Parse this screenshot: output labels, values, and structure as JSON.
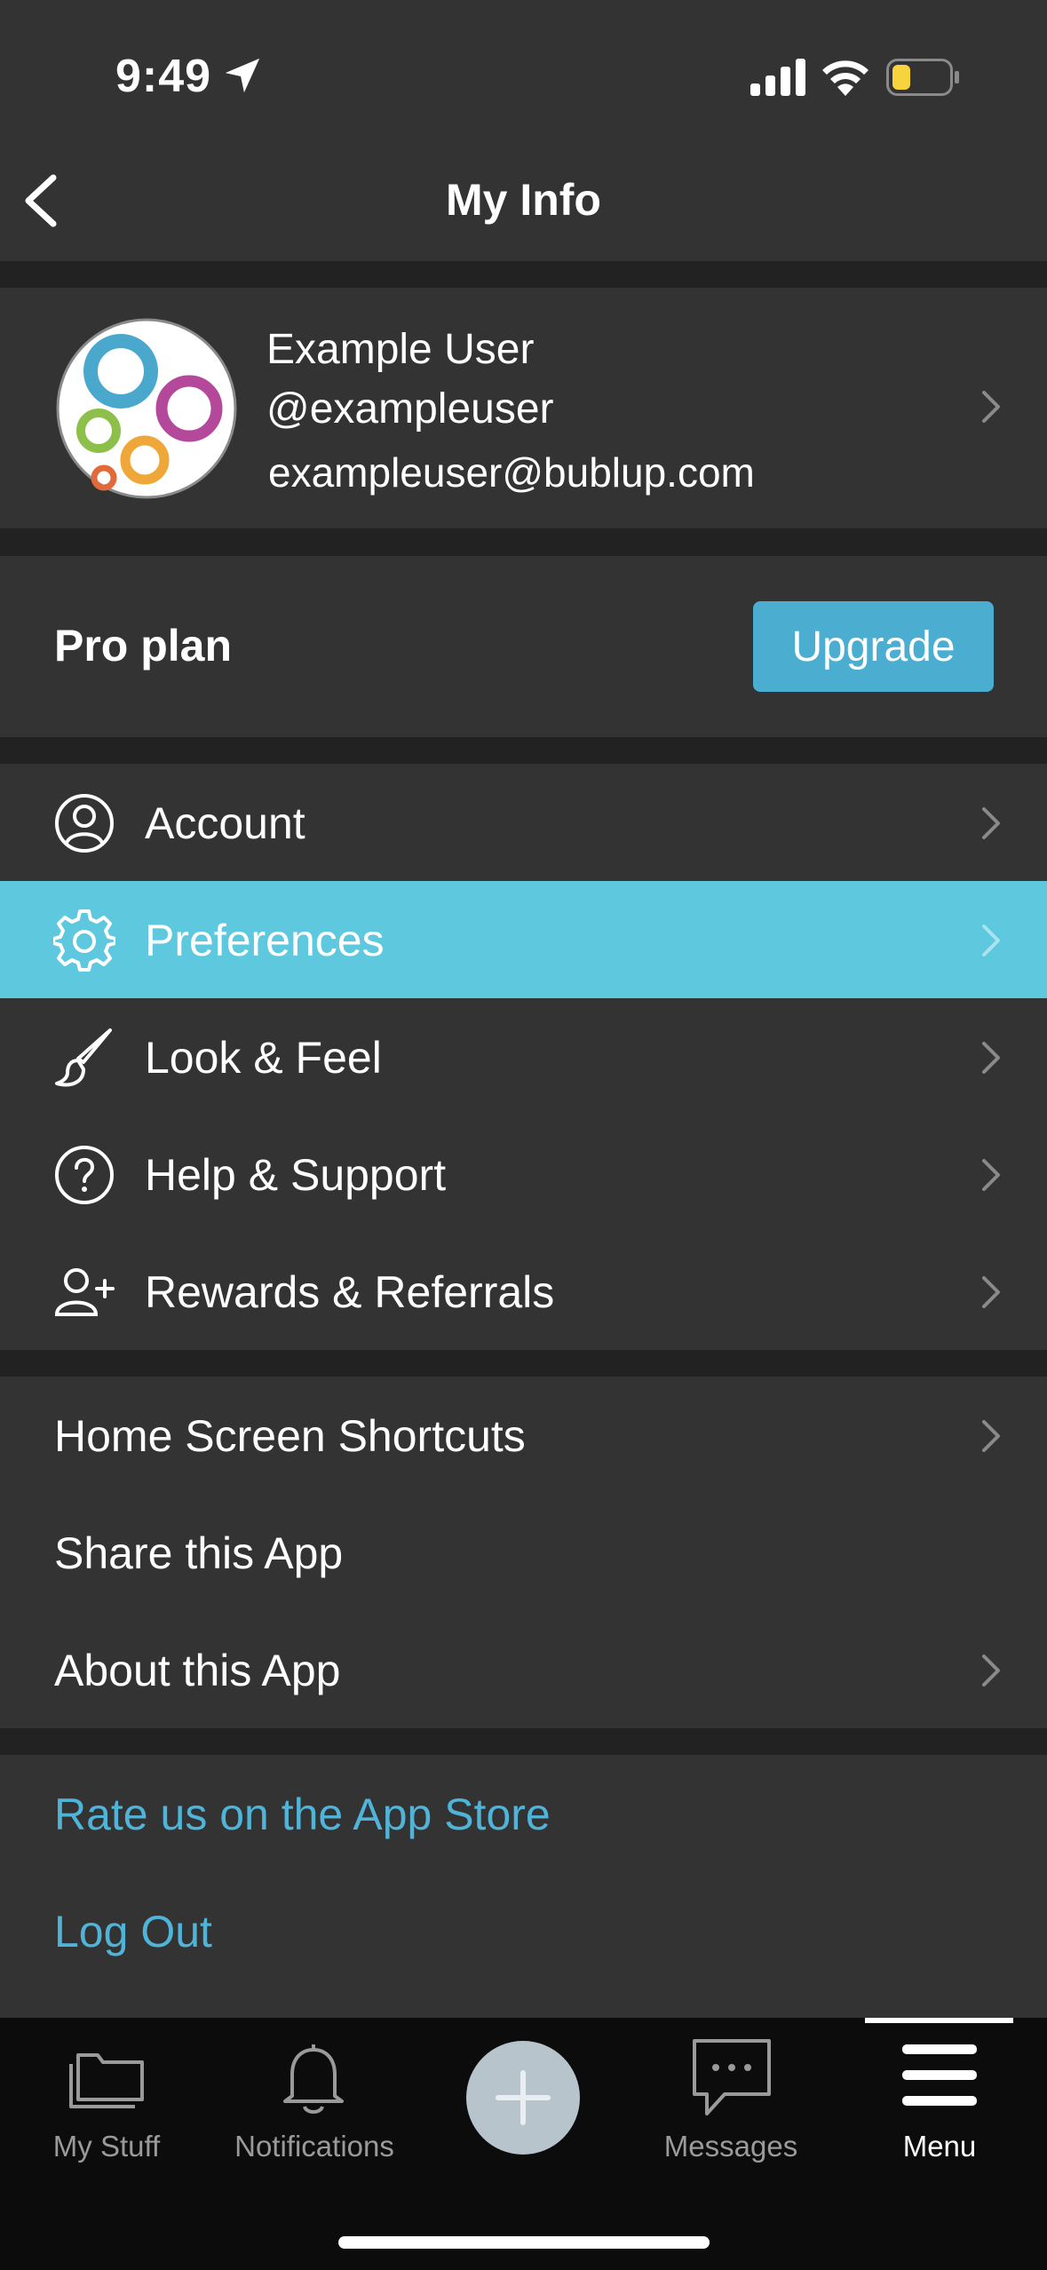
{
  "status_bar": {
    "time": "9:49"
  },
  "header": {
    "title": "My Info"
  },
  "profile": {
    "name": "Example User",
    "handle": "@exampleuser",
    "email": "exampleuser@bublup.com"
  },
  "plan": {
    "label": "Pro plan",
    "upgrade_label": "Upgrade"
  },
  "settings_rows": [
    {
      "label": "Account",
      "icon": "account-icon"
    },
    {
      "label": "Preferences",
      "icon": "gear-icon"
    },
    {
      "label": "Look & Feel",
      "icon": "paintbrush-icon"
    },
    {
      "label": "Help & Support",
      "icon": "help-icon"
    },
    {
      "label": "Rewards & Referrals",
      "icon": "add-user-icon"
    }
  ],
  "app_rows": [
    {
      "label": "Home Screen Shortcuts"
    },
    {
      "label": "Share this App"
    },
    {
      "label": "About this App"
    }
  ],
  "link_rows": [
    {
      "label": "Rate us on the App Store"
    },
    {
      "label": "Log Out"
    }
  ],
  "tabbar": {
    "tabs": [
      {
        "label": "My Stuff",
        "icon": "folder-icon"
      },
      {
        "label": "Notifications",
        "icon": "bell-icon"
      },
      {
        "label": "",
        "icon": "plus-icon"
      },
      {
        "label": "Messages",
        "icon": "chat-icon"
      },
      {
        "label": "Menu",
        "icon": "hamburger-icon"
      }
    ],
    "active": "Menu"
  },
  "colors": {
    "accent": "#4badcf",
    "highlight_row": "#5ec8de",
    "link": "#4fb4d8",
    "surface": "#333333",
    "separator": "#222222"
  }
}
